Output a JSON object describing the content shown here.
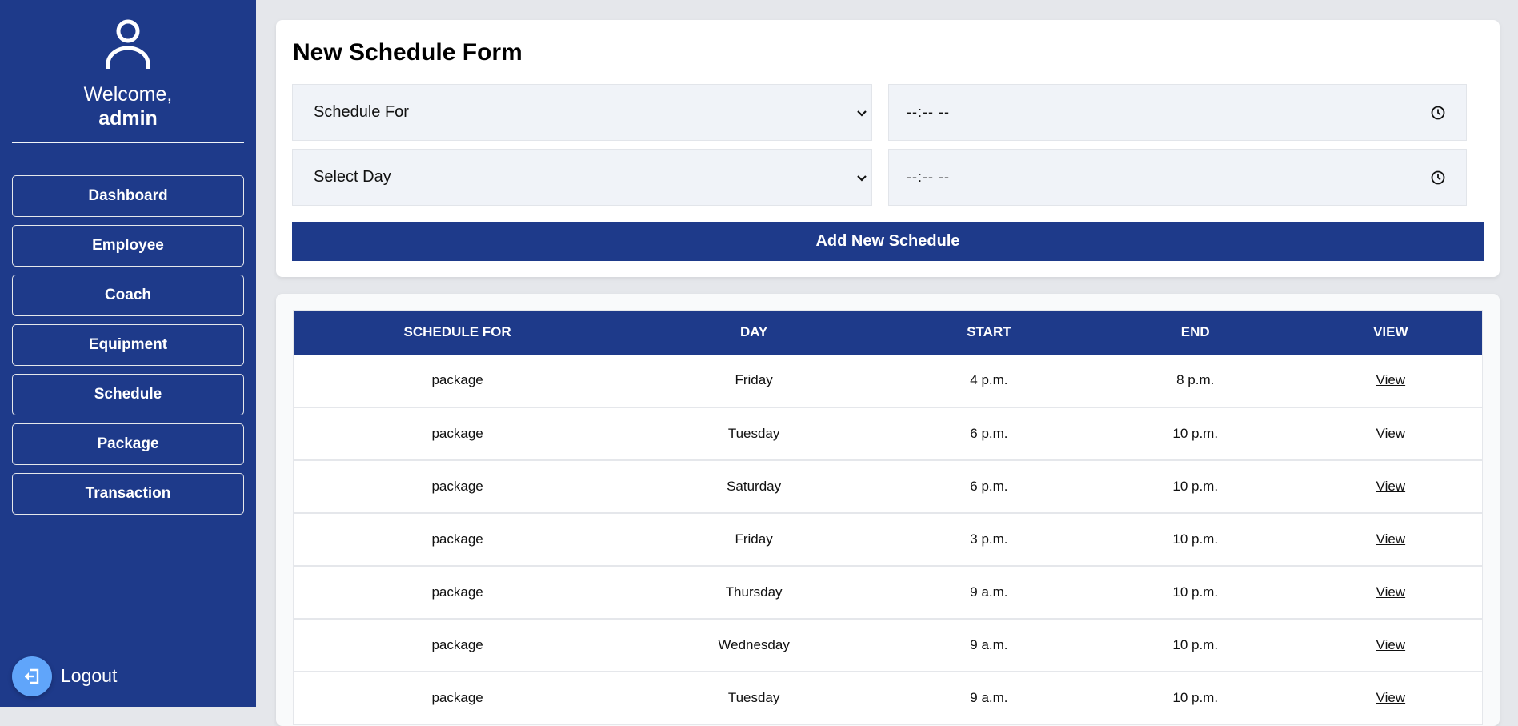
{
  "sidebar": {
    "welcome_line": "Welcome,",
    "username": "admin",
    "nav": [
      {
        "label": "Dashboard"
      },
      {
        "label": "Employee"
      },
      {
        "label": "Coach"
      },
      {
        "label": "Equipment"
      },
      {
        "label": "Schedule"
      },
      {
        "label": "Package"
      },
      {
        "label": "Transaction"
      }
    ],
    "logout_label": "Logout"
  },
  "form": {
    "title": "New Schedule Form",
    "schedule_for": {
      "selected": "Schedule For"
    },
    "day": {
      "selected": "Select Day"
    },
    "start_time": {
      "placeholder": "--:-- --"
    },
    "end_time": {
      "placeholder": "--:-- --"
    },
    "submit_label": "Add New Schedule"
  },
  "table": {
    "headers": [
      "SCHEDULE FOR",
      "DAY",
      "START",
      "END",
      "VIEW"
    ],
    "rows": [
      {
        "schedule_for": "package",
        "day": "Friday",
        "start": "4 p.m.",
        "end": "8 p.m.",
        "view": "View"
      },
      {
        "schedule_for": "package",
        "day": "Tuesday",
        "start": "6 p.m.",
        "end": "10 p.m.",
        "view": "View"
      },
      {
        "schedule_for": "package",
        "day": "Saturday",
        "start": "6 p.m.",
        "end": "10 p.m.",
        "view": "View"
      },
      {
        "schedule_for": "package",
        "day": "Friday",
        "start": "3 p.m.",
        "end": "10 p.m.",
        "view": "View"
      },
      {
        "schedule_for": "package",
        "day": "Thursday",
        "start": "9 a.m.",
        "end": "10 p.m.",
        "view": "View"
      },
      {
        "schedule_for": "package",
        "day": "Wednesday",
        "start": "9 a.m.",
        "end": "10 p.m.",
        "view": "View"
      },
      {
        "schedule_for": "package",
        "day": "Tuesday",
        "start": "9 a.m.",
        "end": "10 p.m.",
        "view": "View"
      }
    ]
  },
  "icons": {
    "user": "user-icon",
    "logout": "logout-icon",
    "chevron": "chevron-down-icon",
    "clock": "clock-icon"
  },
  "colors": {
    "primary": "#1e3a8a",
    "logout_accent": "#60a5fa",
    "page_bg": "#e5e7eb",
    "input_bg": "#f0f3f8"
  }
}
